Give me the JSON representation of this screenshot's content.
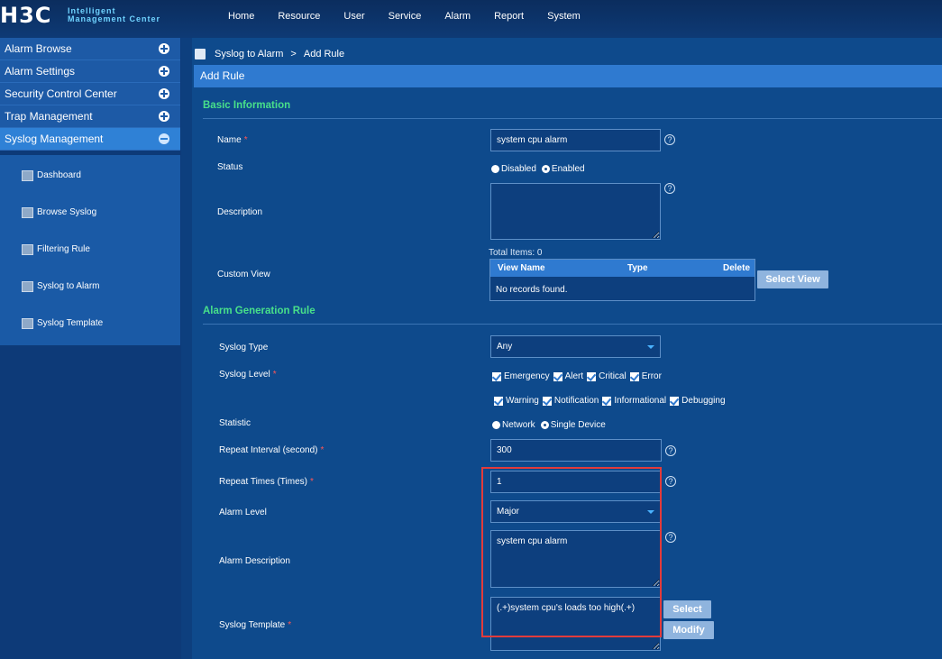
{
  "app": {
    "logo": "H3C",
    "logo_subtitle": "Intelligent Management Center"
  },
  "nav": [
    "Home",
    "Resource",
    "User",
    "Service",
    "Alarm",
    "Report",
    "System"
  ],
  "sidebar": {
    "sections": [
      {
        "label": "Alarm Browse",
        "icon": "plus-icon"
      },
      {
        "label": "Alarm Settings",
        "icon": "plus-icon"
      },
      {
        "label": "Security Control Center",
        "icon": "plus-icon"
      },
      {
        "label": "Trap Management",
        "icon": "plus-icon"
      },
      {
        "label": "Syslog Management",
        "icon": "minus-icon",
        "active": true
      }
    ],
    "submenu": [
      {
        "label": "Dashboard",
        "icon": "dashboard-icon"
      },
      {
        "label": "Browse Syslog",
        "icon": "browse-syslog-icon"
      },
      {
        "label": "Filtering Rule",
        "icon": "filtering-rule-icon"
      },
      {
        "label": "Syslog to Alarm",
        "icon": "syslog-to-alarm-icon"
      },
      {
        "label": "Syslog Template",
        "icon": "syslog-template-icon"
      }
    ]
  },
  "breadcrumb": {
    "parent": "Syslog to Alarm",
    "separator": ">",
    "current": "Add Rule"
  },
  "page_title": "Add Rule",
  "basic": {
    "section_title": "Basic Information",
    "name_label": "Name",
    "name_value": "system cpu alarm",
    "status_label": "Status",
    "status_options": [
      "Disabled",
      "Enabled"
    ],
    "status_selected": "Enabled",
    "description_label": "Description",
    "description_value": "",
    "custom_view_label": "Custom View",
    "total_items": "Total Items: 0",
    "table_headers": [
      "View Name",
      "Type",
      "Delete"
    ],
    "table_empty": "No records found.",
    "select_view_button": "Select View"
  },
  "alarm_rule": {
    "section_title": "Alarm Generation Rule",
    "syslog_type_label": "Syslog Type",
    "syslog_type_value": "Any",
    "syslog_level_label": "Syslog Level",
    "levels_row1": [
      "Emergency",
      "Alert",
      "Critical",
      "Error"
    ],
    "levels_row2": [
      "Warning",
      "Notification",
      "Informational",
      "Debugging"
    ],
    "statistic_label": "Statistic",
    "statistic_options": [
      "Network",
      "Single Device"
    ],
    "statistic_selected": "Single Device",
    "repeat_interval_label": "Repeat Interval (second)",
    "repeat_interval_value": "300",
    "repeat_times_label": "Repeat Times (Times)",
    "repeat_times_value": "1",
    "alarm_level_label": "Alarm Level",
    "alarm_level_value": "Major",
    "alarm_description_label": "Alarm Description",
    "alarm_description_value": "system cpu alarm",
    "syslog_template_label": "Syslog Template",
    "syslog_template_value": "(.+)system cpu's loads too high(.+)",
    "select_button": "Select",
    "modify_button": "Modify"
  },
  "help_glyph": "?",
  "colors": {
    "accent_green": "#48e08a",
    "highlight_red": "#e23b3b",
    "header_blue": "#2f7ad0"
  }
}
